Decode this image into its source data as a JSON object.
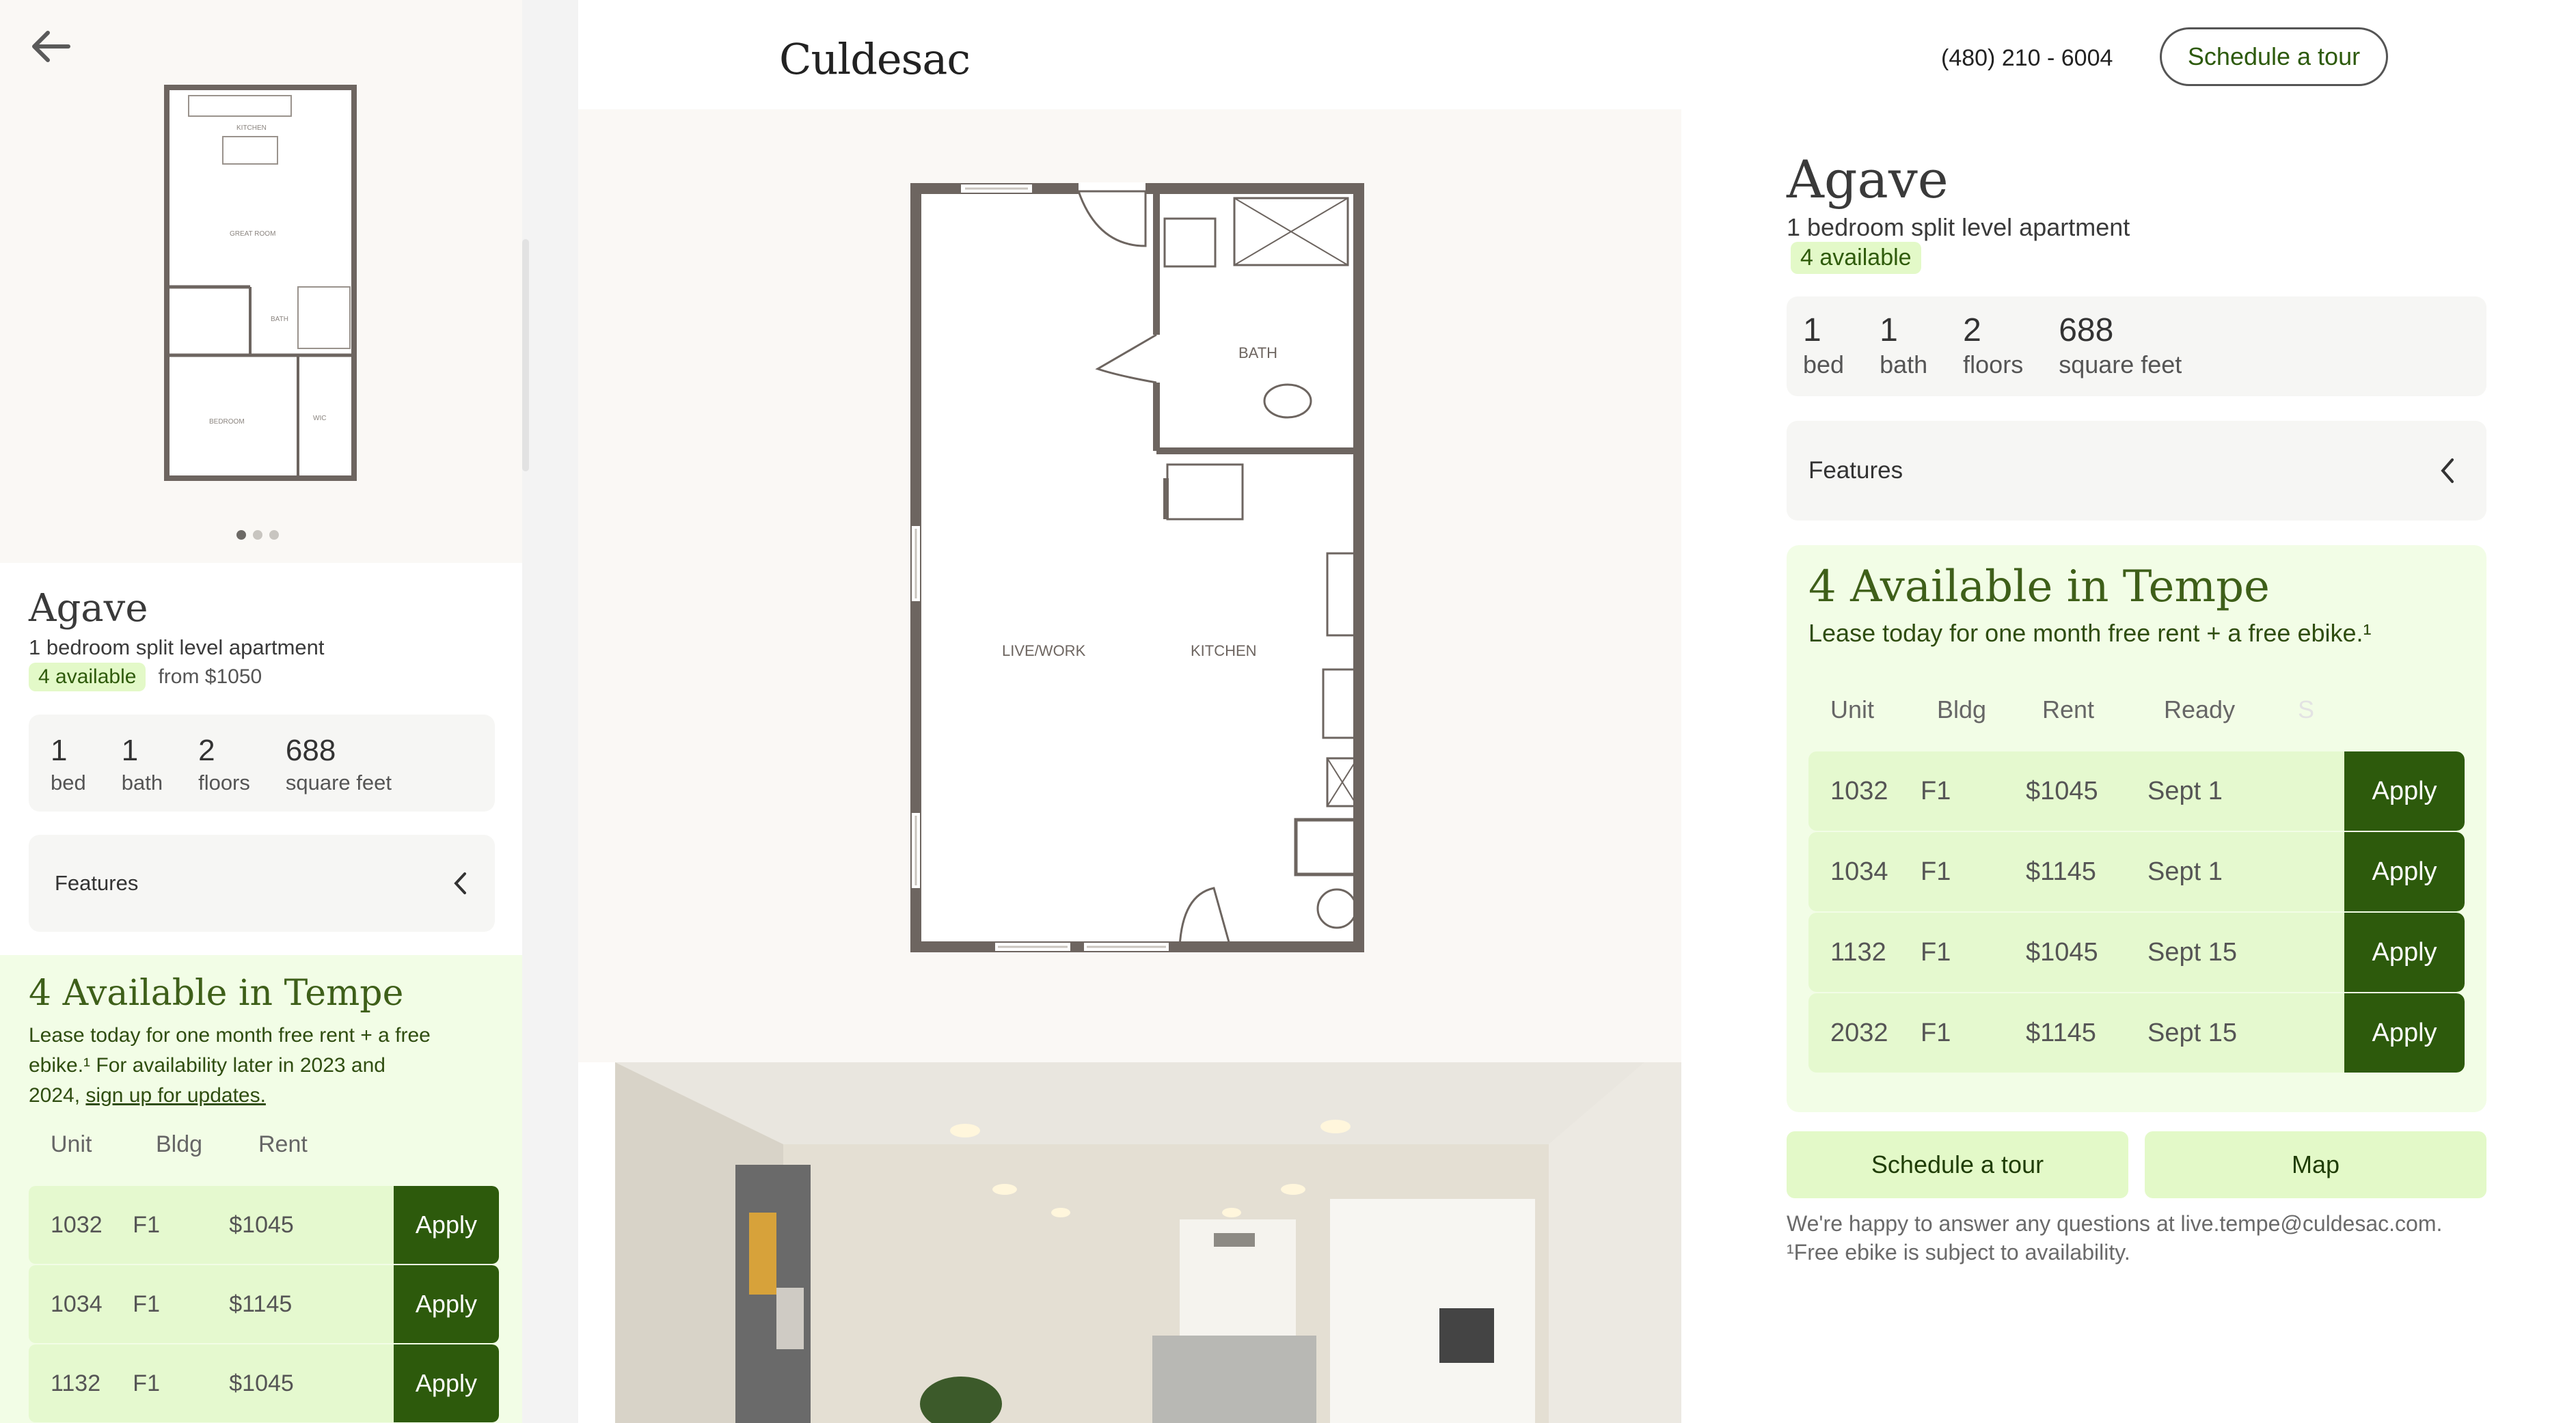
{
  "mobile": {
    "unit_name": "Agave",
    "subtitle": "1 bedroom split level apartment",
    "available_badge": "4 available",
    "from_price": "from $1050",
    "floorplan_labels": [
      "KITCHEN",
      "GREAT ROOM",
      "BATH",
      "BEDROOM",
      "WIC"
    ],
    "specs": [
      {
        "value": "1",
        "label": "bed"
      },
      {
        "value": "1",
        "label": "bath"
      },
      {
        "value": "2",
        "label": "floors"
      },
      {
        "value": "688",
        "label": "square feet"
      }
    ],
    "features_label": "Features",
    "availability": {
      "heading": "4 Available in Tempe",
      "body": "Lease today for one month free rent + a free ebike.¹ For availability later in 2023 and 2024, ",
      "link": "sign up for updates.",
      "columns": [
        "Unit",
        "Bldg",
        "Rent"
      ],
      "rows": [
        {
          "unit": "1032",
          "bldg": "F1",
          "rent": "$1045",
          "action": "Apply"
        },
        {
          "unit": "1034",
          "bldg": "F1",
          "rent": "$1145",
          "action": "Apply"
        },
        {
          "unit": "1132",
          "bldg": "F1",
          "rent": "$1045",
          "action": "Apply"
        }
      ]
    }
  },
  "nav": {
    "logo": "Culdesac",
    "phone": "(480) 210 - 6004",
    "cta": "Schedule a tour"
  },
  "floorplan": {
    "labels": {
      "bath": "BATH",
      "live": "LIVE/WORK",
      "kitchen": "KITCHEN"
    }
  },
  "details": {
    "unit_name": "Agave",
    "subtitle": "1 bedroom split level apartment",
    "available_badge": "4 available",
    "specs": [
      {
        "value": "1",
        "label": "bed"
      },
      {
        "value": "1",
        "label": "bath"
      },
      {
        "value": "2",
        "label": "floors"
      },
      {
        "value": "688",
        "label": "square feet"
      }
    ],
    "features_label": "Features",
    "availability": {
      "heading": "4 Available in Tempe",
      "subheading": "Lease today for one month free rent + a free ebike.¹",
      "columns": [
        "Unit",
        "Bldg",
        "Rent",
        "Ready",
        "S"
      ],
      "rows": [
        {
          "unit": "1032",
          "bldg": "F1",
          "rent": "$1045",
          "ready": "Sept 1",
          "action": "Apply"
        },
        {
          "unit": "1034",
          "bldg": "F1",
          "rent": "$1145",
          "ready": "Sept 1",
          "action": "Apply"
        },
        {
          "unit": "1132",
          "bldg": "F1",
          "rent": "$1045",
          "ready": "Sept 15",
          "action": "Apply"
        },
        {
          "unit": "2032",
          "bldg": "F1",
          "rent": "$1145",
          "ready": "Sept 15",
          "action": "Apply"
        }
      ]
    },
    "schedule_button": "Schedule a tour",
    "map_button": "Map",
    "footer_contact": "We're happy to answer any questions at live.tempe@culdesac.com.",
    "footer_note": "¹Free ebike is subject to availability."
  },
  "colors": {
    "brand_green": "#2d5a0c",
    "heading_green": "#3e5f19",
    "badge_bg": "#e3f9c8",
    "row_bg": "#e5f9cf",
    "panel_bg": "#f2fde6",
    "plan_bg": "#faf8f5"
  },
  "icons": {
    "back": "arrow-left-icon",
    "features_toggle": "chevron-left-icon"
  }
}
